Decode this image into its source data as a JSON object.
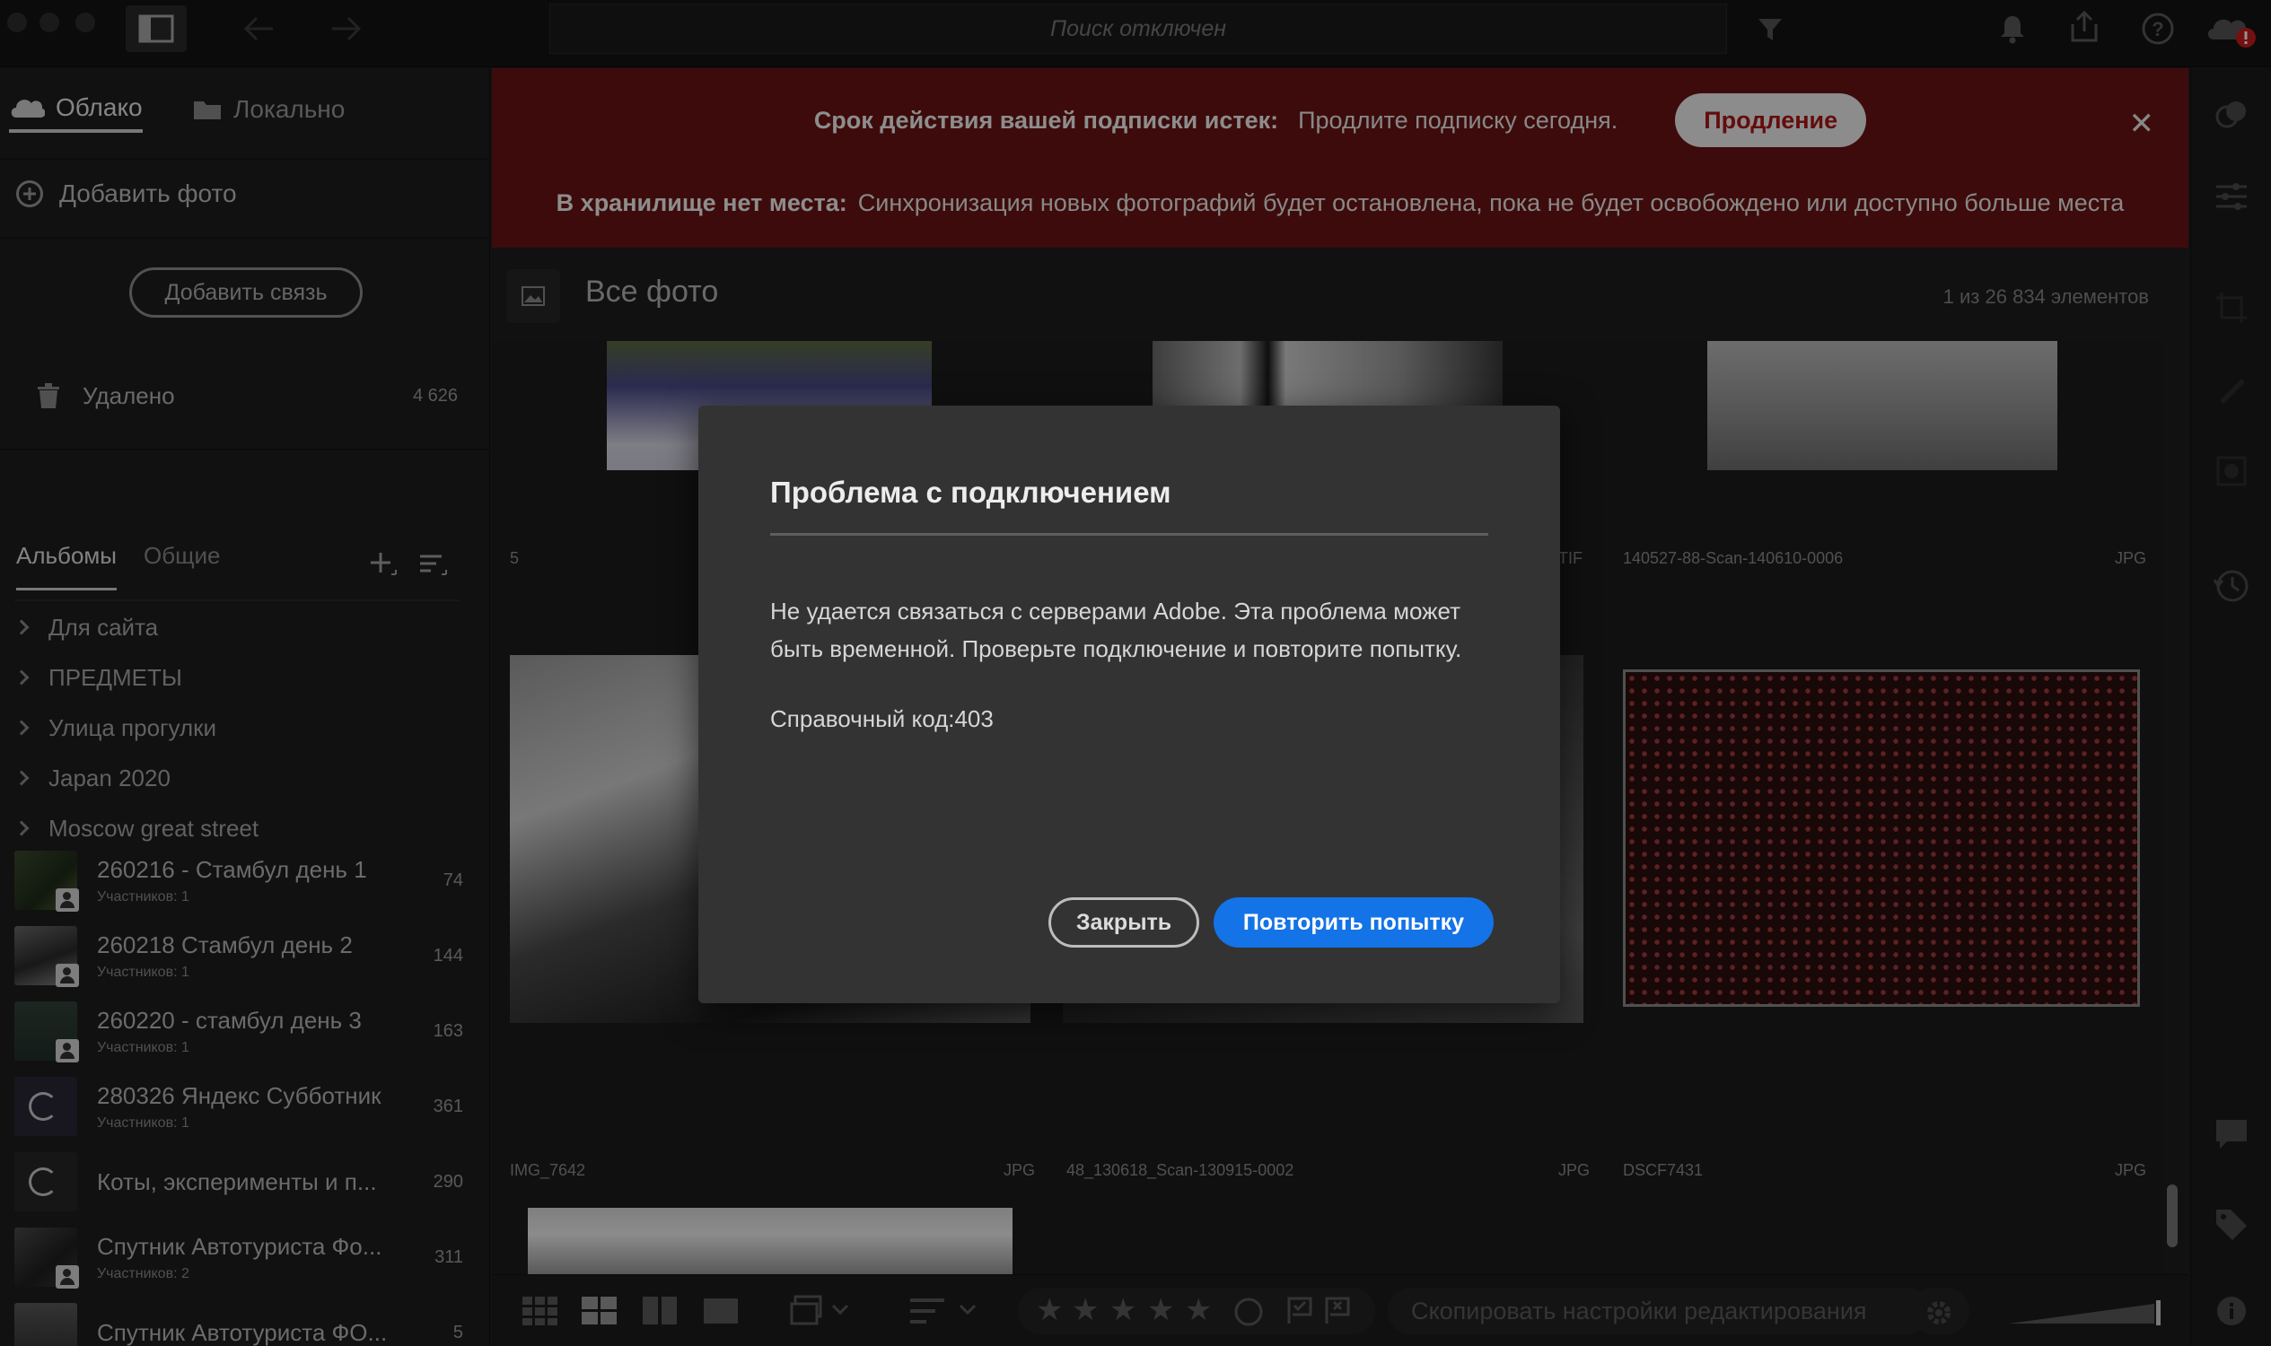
{
  "topbar": {
    "search_placeholder": "Поиск отключен",
    "icons": [
      "sidebar-toggle-icon",
      "back-icon",
      "forward-icon",
      "filter-icon",
      "bell-icon",
      "share-icon",
      "help-icon",
      "cloud-error-icon"
    ]
  },
  "left_panel": {
    "tabs": [
      {
        "label": "Облако",
        "icon": "cloud-icon",
        "active": true
      },
      {
        "label": "Локально",
        "icon": "folder-icon",
        "active": false
      }
    ],
    "add_photo_label": "Добавить фото",
    "add_link_label": "Добавить связь",
    "deleted": {
      "label": "Удалено",
      "count": "4 626"
    },
    "album_tabs": [
      {
        "label": "Альбомы",
        "active": true
      },
      {
        "label": "Общие",
        "active": false
      }
    ],
    "folders": [
      "Для сайта",
      "ПРЕДМЕТЫ",
      "Улица прогулки",
      "Japan 2020",
      "Moscow great street"
    ],
    "albums": [
      {
        "name": "260216 - Стамбул день 1",
        "sub": "Участников: 1",
        "count": "74"
      },
      {
        "name": "260218 Стамбул день 2",
        "sub": "Участников: 1",
        "count": "144"
      },
      {
        "name": "260220 - стамбул день 3",
        "sub": "Участников: 1",
        "count": "163"
      },
      {
        "name": "280326 Яндекс Субботник",
        "sub": "Участников: 1",
        "count": "361"
      },
      {
        "name": "Коты, эксперименты и п...",
        "sub": "",
        "count": "290"
      },
      {
        "name": "Спутник Автотуриста Фо...",
        "sub": "Участников: 2",
        "count": "311"
      },
      {
        "name": "Спутник Автотуриста ФО...",
        "sub": "",
        "count": "5"
      }
    ]
  },
  "banners": {
    "subscription_bold": "Срок действия вашей подписки истек:",
    "subscription_text": "Продлите подписку сегодня.",
    "renew_label": "Продление",
    "storage_bold": "В хранилище нет места:",
    "storage_text": "Синхронизация новых фотографий будет остановлена, пока не будет освобождено или доступно больше места"
  },
  "content": {
    "title": "Все фото",
    "count": "1 из 26 834 элементов",
    "labels": {
      "r2c1_left": "5",
      "r2c2_right": "TIF",
      "r2c3_left": "140527-88-Scan-140610-0006",
      "r2c3_right": "JPG",
      "r3c1_left": "IMG_7642",
      "r3c1_right": "JPG",
      "r3c2_left": "48_130618_Scan-130915-0002",
      "r3c2_right": "JPG",
      "r3c3_left": "DSCF7431",
      "r3c3_right": "JPG"
    }
  },
  "bottombar": {
    "copy_settings_label": "Скопировать настройки редактирования",
    "rating_stars": 5
  },
  "dialog": {
    "title": "Проблема с подключением",
    "body": "Не удается связаться с серверами Adobe. Эта проблема может быть временной. Проверьте подключение и повторите попытку.",
    "code": "Справочный код:403",
    "close_label": "Закрыть",
    "retry_label": "Повторить попытку"
  },
  "colors": {
    "banner_red": "#6a1414",
    "accent_blue": "#1473e6",
    "renew_text": "#ac1616"
  }
}
